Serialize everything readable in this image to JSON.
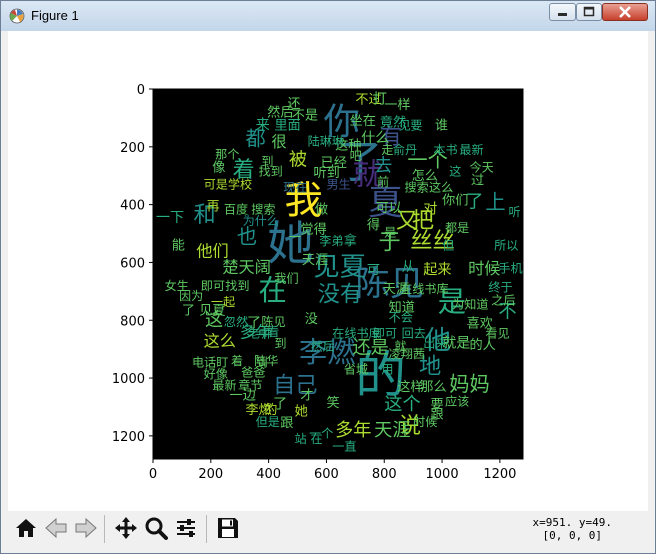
{
  "window": {
    "title": "Figure 1",
    "icons": {
      "app": "matplotlib-figure-icon",
      "minimize": "minimize-icon",
      "maximize": "maximize-icon",
      "close": "close-icon"
    }
  },
  "plot": {
    "background_color": "#000000",
    "x_ticks": [
      "0",
      "200",
      "400",
      "600",
      "800",
      "1000",
      "1200"
    ],
    "y_ticks": [
      "0",
      "200",
      "400",
      "600",
      "800",
      "1000",
      "1200"
    ],
    "x_tick_values": [
      0,
      200,
      400,
      600,
      800,
      1000,
      1200
    ],
    "y_tick_values": [
      0,
      200,
      400,
      600,
      800,
      1000,
      1200
    ],
    "x_range": [
      0,
      1280
    ],
    "y_range": [
      0,
      1280
    ],
    "palette": [
      "#440154",
      "#472d7b",
      "#3b528b",
      "#2c728e",
      "#21918c",
      "#28ae80",
      "#5ec962",
      "#addc30",
      "#fde725"
    ],
    "words": [
      {
        "t": "的",
        "x": 700,
        "y": 1050,
        "s": 50,
        "c": 4
      },
      {
        "t": "她",
        "x": 395,
        "y": 590,
        "s": 46,
        "c": 3
      },
      {
        "t": "了",
        "x": 640,
        "y": 305,
        "s": 44,
        "c": 3
      },
      {
        "t": "我",
        "x": 455,
        "y": 430,
        "s": 38,
        "c": 8
      },
      {
        "t": "你",
        "x": 590,
        "y": 155,
        "s": 36,
        "c": 3
      },
      {
        "t": "陈见",
        "x": 700,
        "y": 715,
        "s": 34,
        "c": 3
      },
      {
        "t": "夏",
        "x": 745,
        "y": 435,
        "s": 34,
        "c": 2
      },
      {
        "t": "就",
        "x": 690,
        "y": 330,
        "s": 30,
        "c": 1
      },
      {
        "t": "李燃",
        "x": 505,
        "y": 945,
        "s": 28,
        "c": 3
      },
      {
        "t": "是",
        "x": 985,
        "y": 770,
        "s": 28,
        "c": 5
      },
      {
        "t": "在",
        "x": 365,
        "y": 730,
        "s": 28,
        "c": 5
      },
      {
        "t": "他",
        "x": 940,
        "y": 900,
        "s": 26,
        "c": 4
      },
      {
        "t": "见夏",
        "x": 555,
        "y": 645,
        "s": 26,
        "c": 4
      },
      {
        "t": "自己",
        "x": 415,
        "y": 1050,
        "s": 22,
        "c": 3
      },
      {
        "t": "丝丝",
        "x": 890,
        "y": 550,
        "s": 22,
        "c": 7
      },
      {
        "t": "有",
        "x": 785,
        "y": 190,
        "s": 22,
        "c": 2
      },
      {
        "t": "着",
        "x": 275,
        "y": 305,
        "s": 22,
        "c": 5
      },
      {
        "t": "地",
        "x": 920,
        "y": 985,
        "s": 22,
        "c": 4
      },
      {
        "t": "和",
        "x": 140,
        "y": 460,
        "s": 22,
        "c": 4
      },
      {
        "t": "一个",
        "x": 880,
        "y": 270,
        "s": 20,
        "c": 6
      },
      {
        "t": "又",
        "x": 840,
        "y": 480,
        "s": 22,
        "c": 7
      },
      {
        "t": "把",
        "x": 895,
        "y": 480,
        "s": 22,
        "c": 7
      },
      {
        "t": "于",
        "x": 780,
        "y": 555,
        "s": 22,
        "c": 6
      },
      {
        "t": "没有",
        "x": 570,
        "y": 735,
        "s": 22,
        "c": 4
      },
      {
        "t": "上",
        "x": 1150,
        "y": 415,
        "s": 20,
        "c": 4
      },
      {
        "t": "都",
        "x": 320,
        "y": 195,
        "s": 20,
        "c": 4
      },
      {
        "t": "也",
        "x": 290,
        "y": 535,
        "s": 20,
        "c": 4
      },
      {
        "t": "说",
        "x": 850,
        "y": 1190,
        "s": 22,
        "c": 7
      },
      {
        "t": "妈妈",
        "x": 1025,
        "y": 1045,
        "s": 20,
        "c": 6
      },
      {
        "t": "还是",
        "x": 690,
        "y": 915,
        "s": 18,
        "c": 6
      },
      {
        "t": "多年",
        "x": 630,
        "y": 1200,
        "s": 18,
        "c": 7
      },
      {
        "t": "天涯",
        "x": 765,
        "y": 1200,
        "s": 18,
        "c": 6
      },
      {
        "t": "这个",
        "x": 800,
        "y": 1110,
        "s": 18,
        "c": 5
      },
      {
        "t": "被",
        "x": 470,
        "y": 265,
        "s": 18,
        "c": 7
      },
      {
        "t": "去",
        "x": 765,
        "y": 285,
        "s": 18,
        "c": 4
      },
      {
        "t": "不",
        "x": 1195,
        "y": 790,
        "s": 18,
        "c": 5
      },
      {
        "t": "楚天阔",
        "x": 240,
        "y": 635,
        "s": 16,
        "c": 6
      },
      {
        "t": "多年",
        "x": 300,
        "y": 860,
        "s": 16,
        "c": 5
      },
      {
        "t": "这么",
        "x": 175,
        "y": 890,
        "s": 16,
        "c": 7
      },
      {
        "t": "这",
        "x": 180,
        "y": 820,
        "s": 18,
        "c": 6
      },
      {
        "t": "他们",
        "x": 150,
        "y": 580,
        "s": 16,
        "c": 7
      },
      {
        "t": "了",
        "x": 1080,
        "y": 410,
        "s": 18,
        "c": 5
      },
      {
        "t": "一下",
        "x": 10,
        "y": 460,
        "s": 14,
        "c": 5
      },
      {
        "t": "时候",
        "x": 1090,
        "y": 640,
        "s": 16,
        "c": 6
      },
      {
        "t": "起来",
        "x": 935,
        "y": 640,
        "s": 14,
        "c": 7
      },
      {
        "t": "然后",
        "x": 395,
        "y": 95,
        "s": 13,
        "c": 6
      },
      {
        "t": "不是",
        "x": 480,
        "y": 105,
        "s": 13,
        "c": 6
      },
      {
        "t": "不过",
        "x": 700,
        "y": 50,
        "s": 13,
        "c": 7
      },
      {
        "t": "打",
        "x": 760,
        "y": 50,
        "s": 14,
        "c": 6
      },
      {
        "t": "一样",
        "x": 800,
        "y": 70,
        "s": 13,
        "c": 6
      },
      {
        "t": "坐在",
        "x": 680,
        "y": 125,
        "s": 13,
        "c": 6
      },
      {
        "t": "竟然",
        "x": 785,
        "y": 130,
        "s": 13,
        "c": 5
      },
      {
        "t": "里面",
        "x": 420,
        "y": 140,
        "s": 13,
        "c": 5
      },
      {
        "t": "来",
        "x": 355,
        "y": 140,
        "s": 14,
        "c": 5
      },
      {
        "t": "谁",
        "x": 975,
        "y": 140,
        "s": 13,
        "c": 6
      },
      {
        "t": "这种",
        "x": 630,
        "y": 210,
        "s": 13,
        "c": 6
      },
      {
        "t": "什么",
        "x": 720,
        "y": 185,
        "s": 14,
        "c": 6
      },
      {
        "t": "很",
        "x": 410,
        "y": 200,
        "s": 15,
        "c": 6
      },
      {
        "t": "已经",
        "x": 580,
        "y": 270,
        "s": 13,
        "c": 6
      },
      {
        "t": "听到",
        "x": 555,
        "y": 305,
        "s": 13,
        "c": 6
      },
      {
        "t": "到",
        "x": 375,
        "y": 265,
        "s": 12,
        "c": 6
      },
      {
        "t": "找到",
        "x": 365,
        "y": 300,
        "s": 12,
        "c": 6
      },
      {
        "t": "可是学校",
        "x": 175,
        "y": 345,
        "s": 12,
        "c": 7
      },
      {
        "t": "像",
        "x": 205,
        "y": 285,
        "s": 13,
        "c": 6
      },
      {
        "t": "那个",
        "x": 215,
        "y": 240,
        "s": 12,
        "c": 6
      },
      {
        "t": "再",
        "x": 185,
        "y": 420,
        "s": 13,
        "c": 7
      },
      {
        "t": "百度",
        "x": 245,
        "y": 430,
        "s": 12,
        "c": 6
      },
      {
        "t": "搜索",
        "x": 340,
        "y": 430,
        "s": 12,
        "c": 6
      },
      {
        "t": "觉得",
        "x": 510,
        "y": 500,
        "s": 13,
        "c": 6
      },
      {
        "t": "做",
        "x": 560,
        "y": 430,
        "s": 13,
        "c": 6
      },
      {
        "t": "天涯",
        "x": 515,
        "y": 605,
        "s": 13,
        "c": 6
      },
      {
        "t": "我们",
        "x": 420,
        "y": 670,
        "s": 12,
        "c": 6
      },
      {
        "t": "可以",
        "x": 770,
        "y": 425,
        "s": 13,
        "c": 6
      },
      {
        "t": "对",
        "x": 935,
        "y": 430,
        "s": 14,
        "c": 7
      },
      {
        "t": "你们",
        "x": 1000,
        "y": 400,
        "s": 13,
        "c": 6
      },
      {
        "t": "过",
        "x": 1100,
        "y": 330,
        "s": 13,
        "c": 6
      },
      {
        "t": "今天",
        "x": 1095,
        "y": 285,
        "s": 12,
        "c": 6
      },
      {
        "t": "怎么",
        "x": 895,
        "y": 315,
        "s": 13,
        "c": 6
      },
      {
        "t": "搜索",
        "x": 870,
        "y": 355,
        "s": 12,
        "c": 6
      },
      {
        "t": "这么",
        "x": 955,
        "y": 355,
        "s": 12,
        "c": 6
      },
      {
        "t": "在线书库",
        "x": 855,
        "y": 705,
        "s": 12,
        "c": 6
      },
      {
        "t": "天涯",
        "x": 795,
        "y": 705,
        "s": 13,
        "c": 6
      },
      {
        "t": "知道",
        "x": 815,
        "y": 770,
        "s": 13,
        "c": 6
      },
      {
        "t": "为知道",
        "x": 1035,
        "y": 760,
        "s": 12,
        "c": 6
      },
      {
        "t": "之后",
        "x": 1170,
        "y": 745,
        "s": 12,
        "c": 6
      },
      {
        "t": "喜欢",
        "x": 1085,
        "y": 825,
        "s": 13,
        "c": 6
      },
      {
        "t": "看见",
        "x": 1150,
        "y": 860,
        "s": 12,
        "c": 6
      },
      {
        "t": "就是",
        "x": 1000,
        "y": 895,
        "s": 14,
        "c": 6
      },
      {
        "t": "的人",
        "x": 1095,
        "y": 900,
        "s": 13,
        "c": 6
      },
      {
        "t": "凌翔茜",
        "x": 815,
        "y": 930,
        "s": 12,
        "c": 6
      },
      {
        "t": "这样",
        "x": 845,
        "y": 1045,
        "s": 13,
        "c": 6
      },
      {
        "t": "那么",
        "x": 925,
        "y": 1045,
        "s": 13,
        "c": 6
      },
      {
        "t": "跟",
        "x": 960,
        "y": 1140,
        "s": 13,
        "c": 6
      },
      {
        "t": "应该",
        "x": 1010,
        "y": 1095,
        "s": 12,
        "c": 6
      },
      {
        "t": "一边",
        "x": 265,
        "y": 1075,
        "s": 13,
        "c": 6
      },
      {
        "t": "李燃",
        "x": 320,
        "y": 1125,
        "s": 13,
        "c": 7
      },
      {
        "t": "的",
        "x": 385,
        "y": 1125,
        "s": 13,
        "c": 7
      },
      {
        "t": "了",
        "x": 415,
        "y": 1105,
        "s": 14,
        "c": 6
      },
      {
        "t": "她",
        "x": 490,
        "y": 1130,
        "s": 13,
        "c": 7
      },
      {
        "t": "才",
        "x": 510,
        "y": 1075,
        "s": 13,
        "c": 6
      },
      {
        "t": "电话盯",
        "x": 135,
        "y": 960,
        "s": 12,
        "c": 6
      },
      {
        "t": "着",
        "x": 270,
        "y": 955,
        "s": 12,
        "c": 6
      },
      {
        "t": "陆华",
        "x": 350,
        "y": 955,
        "s": 12,
        "c": 6
      },
      {
        "t": "最新",
        "x": 205,
        "y": 1040,
        "s": 12,
        "c": 6
      },
      {
        "t": "章节",
        "x": 295,
        "y": 1040,
        "s": 12,
        "c": 6
      },
      {
        "t": "爸爸",
        "x": 305,
        "y": 995,
        "s": 12,
        "c": 6
      },
      {
        "t": "好像",
        "x": 175,
        "y": 1000,
        "s": 12,
        "c": 6
      },
      {
        "t": "但是",
        "x": 355,
        "y": 1165,
        "s": 12,
        "c": 5
      },
      {
        "t": "跟",
        "x": 440,
        "y": 1170,
        "s": 13,
        "c": 6
      },
      {
        "t": "站",
        "x": 490,
        "y": 1225,
        "s": 12,
        "c": 5
      },
      {
        "t": "在",
        "x": 545,
        "y": 1225,
        "s": 12,
        "c": 5
      },
      {
        "t": "一直",
        "x": 620,
        "y": 1250,
        "s": 12,
        "c": 5
      },
      {
        "t": "要",
        "x": 960,
        "y": 1105,
        "s": 13,
        "c": 6
      },
      {
        "t": "时候",
        "x": 900,
        "y": 1165,
        "s": 12,
        "c": 6
      },
      {
        "t": "忽然",
        "x": 245,
        "y": 820,
        "s": 12,
        "c": 5
      },
      {
        "t": "了",
        "x": 325,
        "y": 825,
        "s": 14,
        "c": 6
      },
      {
        "t": "陈见",
        "x": 375,
        "y": 820,
        "s": 12,
        "c": 6
      },
      {
        "t": "了 见夏",
        "x": 100,
        "y": 780,
        "s": 13,
        "c": 6
      },
      {
        "t": "因为",
        "x": 90,
        "y": 730,
        "s": 12,
        "c": 6
      },
      {
        "t": "女生",
        "x": 40,
        "y": 695,
        "s": 12,
        "c": 6
      },
      {
        "t": "一起",
        "x": 200,
        "y": 750,
        "s": 12,
        "c": 7
      },
      {
        "t": "老师",
        "x": 330,
        "y": 860,
        "s": 12,
        "c": 5
      },
      {
        "t": "看",
        "x": 395,
        "y": 855,
        "s": 12,
        "c": 5
      },
      {
        "t": "在线书库",
        "x": 620,
        "y": 860,
        "s": 12,
        "c": 5
      },
      {
        "t": "即可",
        "x": 760,
        "y": 860,
        "s": 12,
        "c": 5
      },
      {
        "t": "回去",
        "x": 860,
        "y": 860,
        "s": 12,
        "c": 5
      },
      {
        "t": "出来",
        "x": 935,
        "y": 895,
        "s": 12,
        "c": 5
      },
      {
        "t": "不会",
        "x": 815,
        "y": 805,
        "s": 12,
        "c": 5
      },
      {
        "t": "可",
        "x": 740,
        "y": 640,
        "s": 13,
        "c": 5
      },
      {
        "t": "从",
        "x": 860,
        "y": 630,
        "s": 13,
        "c": 5
      },
      {
        "t": "拿",
        "x": 660,
        "y": 540,
        "s": 13,
        "c": 5
      },
      {
        "t": "李弟",
        "x": 575,
        "y": 540,
        "s": 12,
        "c": 5
      },
      {
        "t": "得",
        "x": 740,
        "y": 485,
        "s": 13,
        "c": 6
      },
      {
        "t": "男生",
        "x": 600,
        "y": 345,
        "s": 12,
        "c": 2
      },
      {
        "t": "还",
        "x": 465,
        "y": 65,
        "s": 13,
        "c": 6
      },
      {
        "t": "陆琳琳",
        "x": 535,
        "y": 195,
        "s": 12,
        "c": 5
      },
      {
        "t": "走",
        "x": 790,
        "y": 225,
        "s": 12,
        "c": 6
      },
      {
        "t": "俞丹",
        "x": 830,
        "y": 225,
        "s": 12,
        "c": 5
      },
      {
        "t": "本书",
        "x": 970,
        "y": 225,
        "s": 12,
        "c": 5
      },
      {
        "t": "最新",
        "x": 1060,
        "y": 225,
        "s": 12,
        "c": 5
      },
      {
        "t": "见",
        "x": 850,
        "y": 140,
        "s": 12,
        "c": 5
      },
      {
        "t": "要",
        "x": 890,
        "y": 140,
        "s": 12,
        "c": 5
      },
      {
        "t": "都是",
        "x": 1010,
        "y": 495,
        "s": 12,
        "c": 6
      },
      {
        "t": "所以",
        "x": 1180,
        "y": 555,
        "s": 12,
        "c": 5
      },
      {
        "t": "手机",
        "x": 1195,
        "y": 635,
        "s": 12,
        "c": 5
      },
      {
        "t": "终于",
        "x": 1160,
        "y": 700,
        "s": 12,
        "c": 5
      },
      {
        "t": "听",
        "x": 1230,
        "y": 440,
        "s": 12,
        "c": 5
      },
      {
        "t": "但",
        "x": 1000,
        "y": 555,
        "s": 12,
        "c": 5
      },
      {
        "t": "没",
        "x": 525,
        "y": 810,
        "s": 13,
        "c": 6
      },
      {
        "t": "找到",
        "x": 250,
        "y": 695,
        "s": 12,
        "c": 6
      },
      {
        "t": "即可",
        "x": 165,
        "y": 695,
        "s": 12,
        "c": 6
      },
      {
        "t": "到",
        "x": 355,
        "y": 960,
        "s": 12,
        "c": 6
      },
      {
        "t": "用",
        "x": 790,
        "y": 985,
        "s": 12,
        "c": 5
      },
      {
        "t": "一",
        "x": 470,
        "y": 525,
        "s": 12,
        "c": 6
      },
      {
        "t": "能",
        "x": 65,
        "y": 555,
        "s": 13,
        "c": 6
      },
      {
        "t": "为什么",
        "x": 310,
        "y": 470,
        "s": 12,
        "c": 4
      },
      {
        "t": "一个",
        "x": 540,
        "y": 1205,
        "s": 12,
        "c": 5
      },
      {
        "t": "到",
        "x": 420,
        "y": 895,
        "s": 12,
        "c": 6
      },
      {
        "t": "笑",
        "x": 600,
        "y": 1100,
        "s": 13,
        "c": 6
      },
      {
        "t": "然后",
        "x": 545,
        "y": 905,
        "s": 12,
        "c": 5
      },
      {
        "t": "现在",
        "x": 450,
        "y": 355,
        "s": 12,
        "c": 3
      },
      {
        "t": "这",
        "x": 1025,
        "y": 300,
        "s": 12,
        "c": 5
      },
      {
        "t": "是",
        "x": 800,
        "y": 510,
        "s": 12,
        "c": 6
      },
      {
        "t": "省城",
        "x": 660,
        "y": 985,
        "s": 12,
        "c": 6
      },
      {
        "t": "吧",
        "x": 680,
        "y": 245,
        "s": 12,
        "c": 6
      },
      {
        "t": "前",
        "x": 775,
        "y": 335,
        "s": 12,
        "c": 6
      },
      {
        "t": "就",
        "x": 835,
        "y": 905,
        "s": 12,
        "c": 6
      }
    ]
  },
  "toolbar": {
    "icons": [
      "home-icon",
      "back-icon",
      "forward-icon",
      "pan-icon",
      "zoom-icon",
      "configure-subplots-icon",
      "save-icon"
    ],
    "coords_line1": "x=951. y=49.",
    "coords_line2": "[0, 0, 0]"
  }
}
